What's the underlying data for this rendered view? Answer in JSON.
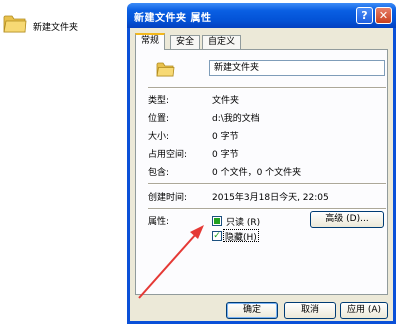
{
  "desktop": {
    "folder_label": "新建文件夹"
  },
  "window": {
    "title": "新建文件夹 属性",
    "help_glyph": "?",
    "close_glyph": "✕"
  },
  "tabs": [
    {
      "label": "常规"
    },
    {
      "label": "安全"
    },
    {
      "label": "自定义"
    }
  ],
  "general": {
    "name_value": "新建文件夹",
    "rows": [
      {
        "label": "类型:",
        "value": "文件夹"
      },
      {
        "label": "位置:",
        "value": "d:\\我的文档"
      },
      {
        "label": "大小:",
        "value": "0 字节"
      },
      {
        "label": "占用空间:",
        "value": "0 字节"
      },
      {
        "label": "包含:",
        "value": "0 个文件，0 个文件夹"
      },
      {
        "label": "创建时间:",
        "value": "2015年3月18日今天, 22:05"
      }
    ],
    "attributes_label": "属性:",
    "readonly_label": "只读 (R)",
    "hidden_label": "隐藏(H)",
    "advanced_button": "高级 (D)..."
  },
  "buttons": {
    "ok": "确定",
    "cancel": "取消",
    "apply": "应用 (A)"
  },
  "colors": {
    "annotation_arrow": "#e53935"
  }
}
